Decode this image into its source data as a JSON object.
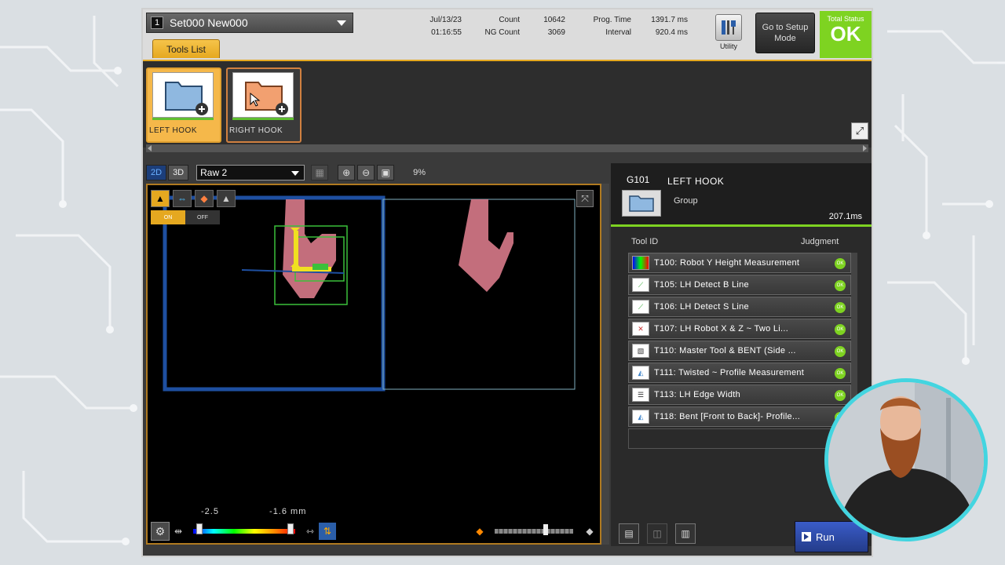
{
  "header": {
    "set_number": "1",
    "set_name": "Set000  New000",
    "date": "Jul/13/23",
    "time": "01:16:55",
    "count_label": "Count",
    "count_value": "10642",
    "ng_label": "NG Count",
    "ng_value": "3069",
    "prog_time_label": "Prog. Time",
    "prog_time_value": "1391.7 ms",
    "interval_label": "Interval",
    "interval_value": "920.4 ms",
    "utility_label": "Utility",
    "setup_label": "Go to Setup Mode",
    "total_status_label": "Total Status",
    "total_status_value": "OK"
  },
  "tools_tab": "Tools List",
  "tool_cards": [
    {
      "label": "LEFT HOOK",
      "color": "#8fb8e0"
    },
    {
      "label": "RIGHT HOOK",
      "color": "#f2a070"
    }
  ],
  "image_toolbar": {
    "mode_2d": "2D",
    "mode_3d": "3D",
    "image_select": "Raw 2",
    "zoom_percent": "9%"
  },
  "image_view": {
    "onoff_on": "ON",
    "onoff_off": "OFF",
    "range_min": "-2.5",
    "range_max": "-1.6 mm"
  },
  "group": {
    "id": "G101",
    "name": "LEFT HOOK",
    "type": "Group",
    "time": "207.1ms"
  },
  "columns": {
    "tool_id": "Tool ID",
    "judgment": "Judgment"
  },
  "tools": [
    {
      "label": "T100: Robot Y Height Measurement",
      "status": "OK"
    },
    {
      "label": "T105: LH Detect B Line",
      "status": "OK"
    },
    {
      "label": "T106: LH Detect S Line",
      "status": "OK"
    },
    {
      "label": "T107: LH Robot X & Z ~  Two Li...",
      "status": "OK"
    },
    {
      "label": "T110: Master Tool & BENT (Side ...",
      "status": "OK"
    },
    {
      "label": "T111: Twisted ~ Profile Measurement",
      "status": "OK"
    },
    {
      "label": "T113: LH Edge Width",
      "status": "OK"
    },
    {
      "label": "T118: Bent [Front to Back]- Profile...",
      "status": "OK"
    }
  ],
  "run_label": "Run",
  "colors": {
    "accent": "#e5a820",
    "ok_green": "#7ed321",
    "run_blue": "#2f4fb0"
  }
}
